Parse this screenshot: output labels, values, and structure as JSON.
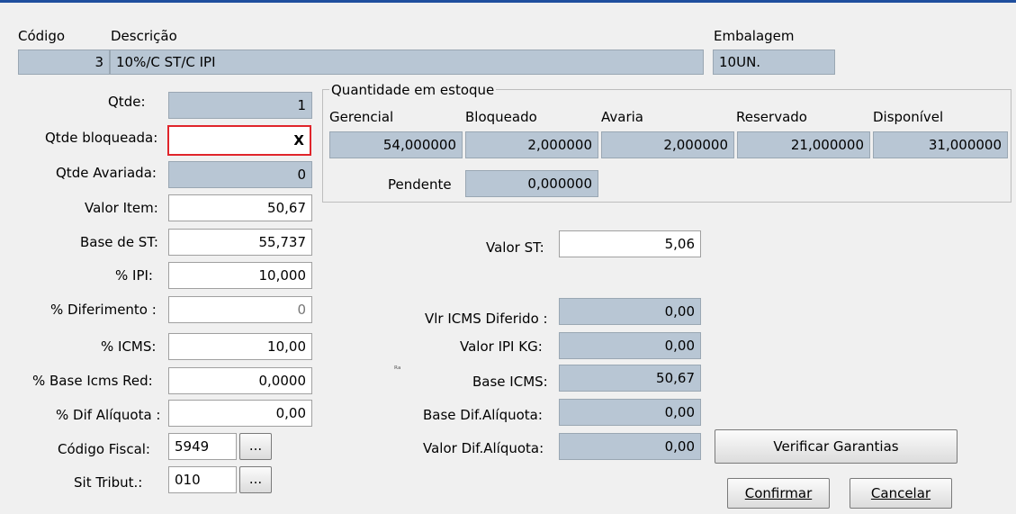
{
  "header": {
    "codigo_label": "Código",
    "descricao_label": "Descrição",
    "embalagem_label": "Embalagem",
    "codigo_value": "3",
    "descricao_value": "10%/C ST/C IPI",
    "embalagem_value": "10UN."
  },
  "left": {
    "qtde_label": "Qtde:",
    "qtde_value": "1",
    "qtde_bloqueada_label": "Qtde bloqueada:",
    "qtde_bloqueada_value": "X",
    "qtde_avariada_label": "Qtde Avariada:",
    "qtde_avariada_value": "0",
    "valor_item_label": "Valor Item:",
    "valor_item_value": "50,67",
    "base_st_label": "Base de ST:",
    "base_st_value": "55,737",
    "pct_ipi_label": "% IPI:",
    "pct_ipi_value": "10,000",
    "pct_diferimento_label": "% Diferimento :",
    "pct_diferimento_value": "0",
    "pct_icms_label": "% ICMS:",
    "pct_icms_value": "10,00",
    "pct_base_icms_red_label": "% Base Icms Red:",
    "pct_base_icms_red_value": "0,0000",
    "pct_dif_aliquota_label": "% Dif Alíquota :",
    "pct_dif_aliquota_value": "0,00",
    "codigo_fiscal_label": "Código Fiscal:",
    "codigo_fiscal_value": "5949",
    "sit_tribut_label": "Sit Tribut.:",
    "sit_tribut_value": "010",
    "ellipsis": "..."
  },
  "estoque": {
    "title": "Quantidade em estoque",
    "gerencial_label": "Gerencial",
    "bloqueado_label": "Bloqueado",
    "avaria_label": "Avaria",
    "reservado_label": "Reservado",
    "disponivel_label": "Disponível",
    "gerencial_value": "54,000000",
    "bloqueado_value": "2,000000",
    "avaria_value": "2,000000",
    "reservado_value": "21,000000",
    "disponivel_value": "31,000000",
    "pendente_label": "Pendente",
    "pendente_value": "0,000000"
  },
  "middle": {
    "valor_st_label": "Valor ST:",
    "valor_st_value": "5,06",
    "vr_icms_diferido_label": "Vlr ICMS Diferido :",
    "vr_icms_diferido_value": "0,00",
    "valor_ipi_kg_label": "Valor IPI KG:",
    "valor_ipi_kg_value": "0,00",
    "base_icms_label": "Base ICMS:",
    "base_icms_value": "50,67",
    "base_dif_aliquota_label": "Base Dif.Alíquota:",
    "base_dif_aliquota_value": "0,00",
    "valor_dif_aliquota_label": "Valor Dif.Alíquota:",
    "valor_dif_aliquota_value": "0,00",
    "stray_mark": "ᴿᵃ"
  },
  "buttons": {
    "verificar_garantias": "Verificar Garantias",
    "confirmar": "Confirmar",
    "cancelar": "Cancelar"
  }
}
